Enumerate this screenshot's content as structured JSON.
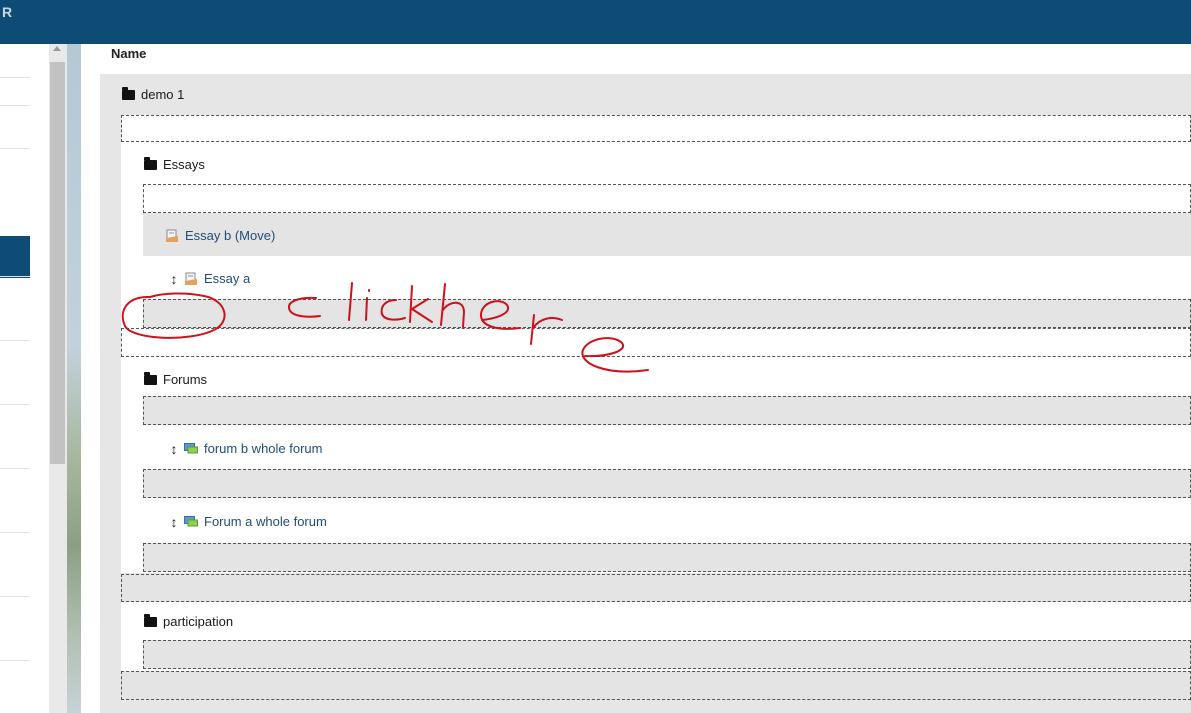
{
  "header": {
    "mark": "R"
  },
  "table": {
    "column_name": "Name"
  },
  "tree": {
    "root": {
      "label": "demo 1"
    },
    "essays": {
      "label": "Essays",
      "moving_item": "Essay b (Move)",
      "item_a": "Essay a"
    },
    "forums": {
      "label": "Forums",
      "item_b": "forum b whole forum",
      "item_a": "Forum a whole forum"
    },
    "participation": {
      "label": "participation"
    }
  },
  "annotation": {
    "handwritten_text": "click here",
    "color": "#d0101a"
  },
  "colors": {
    "header": "#0f4c75",
    "link": "#1f4e79",
    "content_bg": "#e6e6e6"
  },
  "icons": {
    "folder": "folder-icon",
    "move": "move-arrows-icon",
    "essay": "essay-icon",
    "forum": "forum-icon"
  }
}
